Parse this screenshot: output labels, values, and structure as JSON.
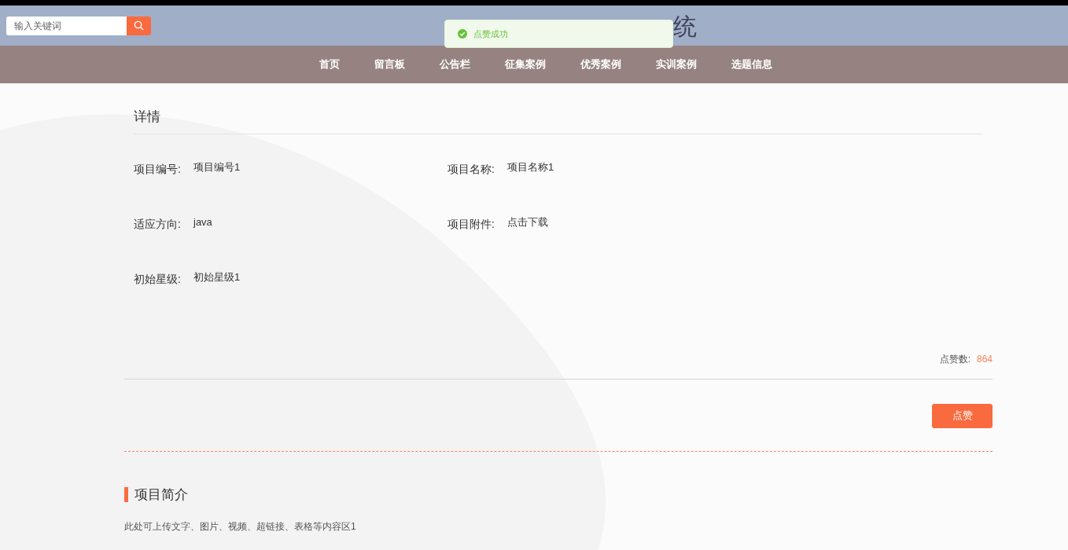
{
  "header": {
    "search": {
      "placeholder": "输入关键词"
    },
    "title_fragment": "统"
  },
  "toast": {
    "message": "点赞成功"
  },
  "nav": [
    {
      "label": "首页"
    },
    {
      "label": "留言板"
    },
    {
      "label": "公告栏"
    },
    {
      "label": "征集案例"
    },
    {
      "label": "优秀案例"
    },
    {
      "label": "实训案例"
    },
    {
      "label": "选题信息"
    }
  ],
  "details": {
    "title": "详情",
    "fields": [
      {
        "label": "项目编号:",
        "value": "项目编号1"
      },
      {
        "label": "项目名称:",
        "value": "项目名称1"
      },
      {
        "label": "适应方向:",
        "value": "java"
      },
      {
        "label": "项目附件:",
        "value": "点击下载"
      },
      {
        "label": "初始星级:",
        "value": "初始星级1"
      }
    ]
  },
  "likes": {
    "label": "点赞数:",
    "count": "864",
    "button": "点赞"
  },
  "intro": {
    "title": "项目简介",
    "text": "此处可上传文字、图片、视频、超链接、表格等内容区1"
  }
}
